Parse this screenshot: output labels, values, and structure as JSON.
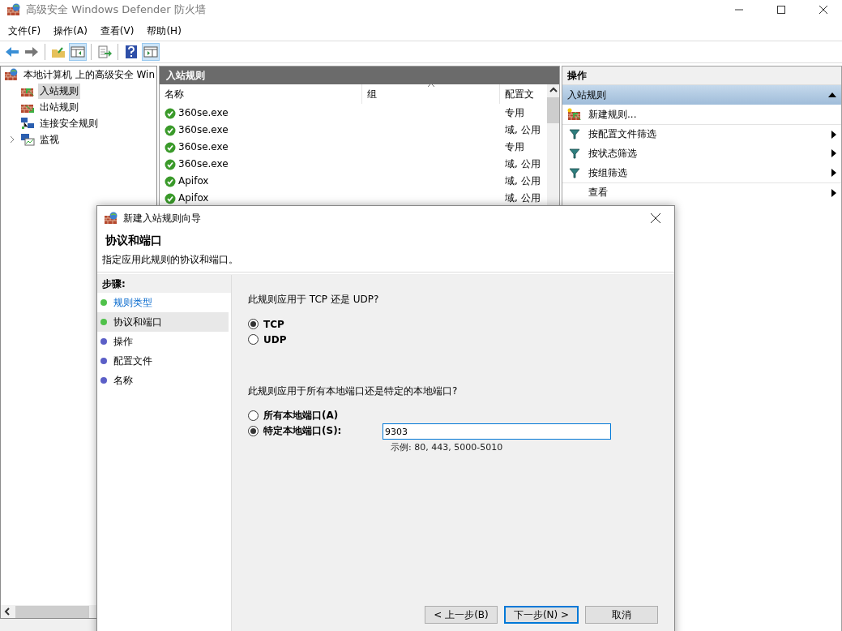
{
  "window": {
    "title": "高级安全 Windows Defender 防火墙"
  },
  "menu": [
    "文件(F)",
    "操作(A)",
    "查看(V)",
    "帮助(H)"
  ],
  "toolbar": [
    {
      "kind": "back",
      "pressed": false
    },
    {
      "kind": "forward",
      "pressed": false
    },
    {
      "kind": "sep"
    },
    {
      "kind": "up",
      "pressed": false
    },
    {
      "kind": "tree",
      "pressed": true
    },
    {
      "kind": "sep"
    },
    {
      "kind": "export",
      "pressed": false
    },
    {
      "kind": "sep"
    },
    {
      "kind": "help",
      "pressed": false
    },
    {
      "kind": "pane",
      "pressed": true
    }
  ],
  "tree": {
    "label": "本地计算机 上的高级安全 Win",
    "children": [
      {
        "label": "入站规则",
        "kind": "inbound",
        "selected": true
      },
      {
        "label": "出站规则",
        "kind": "outbound",
        "selected": false
      },
      {
        "label": "连接安全规则",
        "kind": "connection",
        "selected": false
      },
      {
        "label": "监视",
        "kind": "monitor",
        "selected": false,
        "expanded": false
      }
    ]
  },
  "list": {
    "title": "入站规则",
    "columns": [
      "名称",
      "组",
      "配置文"
    ],
    "rows": [
      {
        "name": "360se.exe",
        "profile": "专用",
        "enabled": true
      },
      {
        "name": "360se.exe",
        "profile": "域, 公用",
        "enabled": true
      },
      {
        "name": "360se.exe",
        "profile": "专用",
        "enabled": true
      },
      {
        "name": "360se.exe",
        "profile": "域, 公用",
        "enabled": true
      },
      {
        "name": "Apifox",
        "profile": "域, 公用",
        "enabled": true
      },
      {
        "name": "Apifox",
        "profile": "域, 公用",
        "enabled": true
      }
    ]
  },
  "actions": {
    "title": "操作",
    "section": {
      "label": "入站规则",
      "expanded": true
    },
    "items": [
      {
        "label": "新建规则...",
        "kind": "new",
        "submenu": false,
        "separator_before": false
      },
      {
        "label": "按配置文件筛选",
        "kind": "filter",
        "submenu": true,
        "separator_before": true
      },
      {
        "label": "按状态筛选",
        "kind": "filter",
        "submenu": true,
        "separator_before": false
      },
      {
        "label": "按组筛选",
        "kind": "filter",
        "submenu": true,
        "separator_before": false
      },
      {
        "label": "查看",
        "kind": "plain",
        "submenu": true,
        "separator_before": true
      }
    ]
  },
  "dialog": {
    "title": "新建入站规则向导",
    "heading": "协议和端口",
    "subtitle": "指定应用此规则的协议和端口。",
    "steps_title": "步骤:",
    "steps": [
      {
        "label": "规则类型",
        "done": true,
        "selected": false,
        "link": true
      },
      {
        "label": "协议和端口",
        "done": true,
        "selected": true,
        "link": false
      },
      {
        "label": "操作",
        "done": false,
        "selected": false,
        "link": false
      },
      {
        "label": "配置文件",
        "done": false,
        "selected": false,
        "link": false
      },
      {
        "label": "名称",
        "done": false,
        "selected": false,
        "link": false
      }
    ],
    "protocol_question": "此规则应用于 TCP 还是 UDP?",
    "protocols": [
      {
        "label": "TCP",
        "selected": true
      },
      {
        "label": "UDP",
        "selected": false
      }
    ],
    "port_question": "此规则应用于所有本地端口还是特定的本地端口?",
    "ports": [
      {
        "label": "所有本地端口(A)",
        "selected": false,
        "kind": "plain"
      },
      {
        "label": "特定本地端口(S):",
        "selected": true,
        "kind": "input",
        "value": "9303",
        "hint": "示例: 80, 443, 5000-5010"
      }
    ],
    "buttons": [
      {
        "label": "< 上一步(B)",
        "default": false
      },
      {
        "label": "下一步(N) >",
        "default": true
      },
      {
        "label": "取消",
        "default": false
      }
    ]
  }
}
